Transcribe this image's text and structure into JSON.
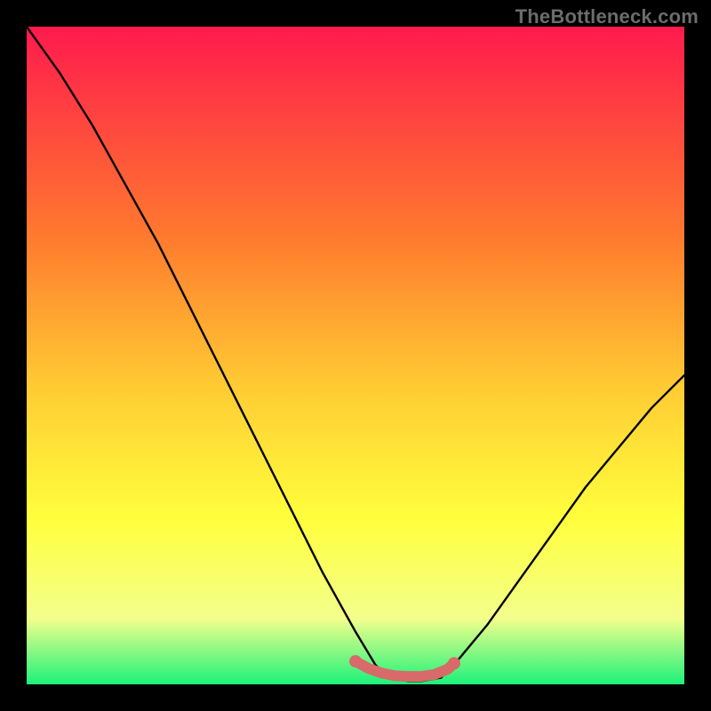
{
  "watermark": {
    "text": "TheBottleneck.com"
  },
  "colors": {
    "black": "#000000",
    "gradient_top": "#ff1a4d",
    "gradient_mid1": "#ff7a2e",
    "gradient_mid2": "#ffcc33",
    "gradient_mid3": "#ffff3d",
    "gradient_mid4": "#f3ff8c",
    "gradient_bottom": "#1cf27a",
    "curve": "#000000",
    "marker": "#d86a6a"
  },
  "chart_data": {
    "type": "line",
    "title": "",
    "xlabel": "",
    "ylabel": "",
    "xlim": [
      0,
      100
    ],
    "ylim": [
      0,
      100
    ],
    "legend": false,
    "grid": false,
    "series": [
      {
        "name": "bottleneck-curve",
        "x": [
          0,
          5,
          10,
          15,
          20,
          25,
          30,
          35,
          40,
          45,
          50,
          53,
          55,
          58,
          60,
          63,
          65,
          70,
          75,
          80,
          85,
          90,
          95,
          100
        ],
        "values": [
          100,
          93,
          85,
          76,
          67,
          57,
          47,
          37,
          27,
          17,
          8,
          3,
          1,
          0.5,
          0.5,
          1,
          3,
          9,
          16,
          23,
          30,
          36,
          42,
          47
        ]
      }
    ],
    "annotations": [
      {
        "name": "optimal-band",
        "x": [
          50,
          52,
          54,
          56,
          58,
          60,
          62,
          64,
          65
        ],
        "values": [
          3.5,
          2.4,
          1.7,
          1.3,
          1.2,
          1.2,
          1.5,
          2.3,
          3.2
        ]
      }
    ]
  }
}
